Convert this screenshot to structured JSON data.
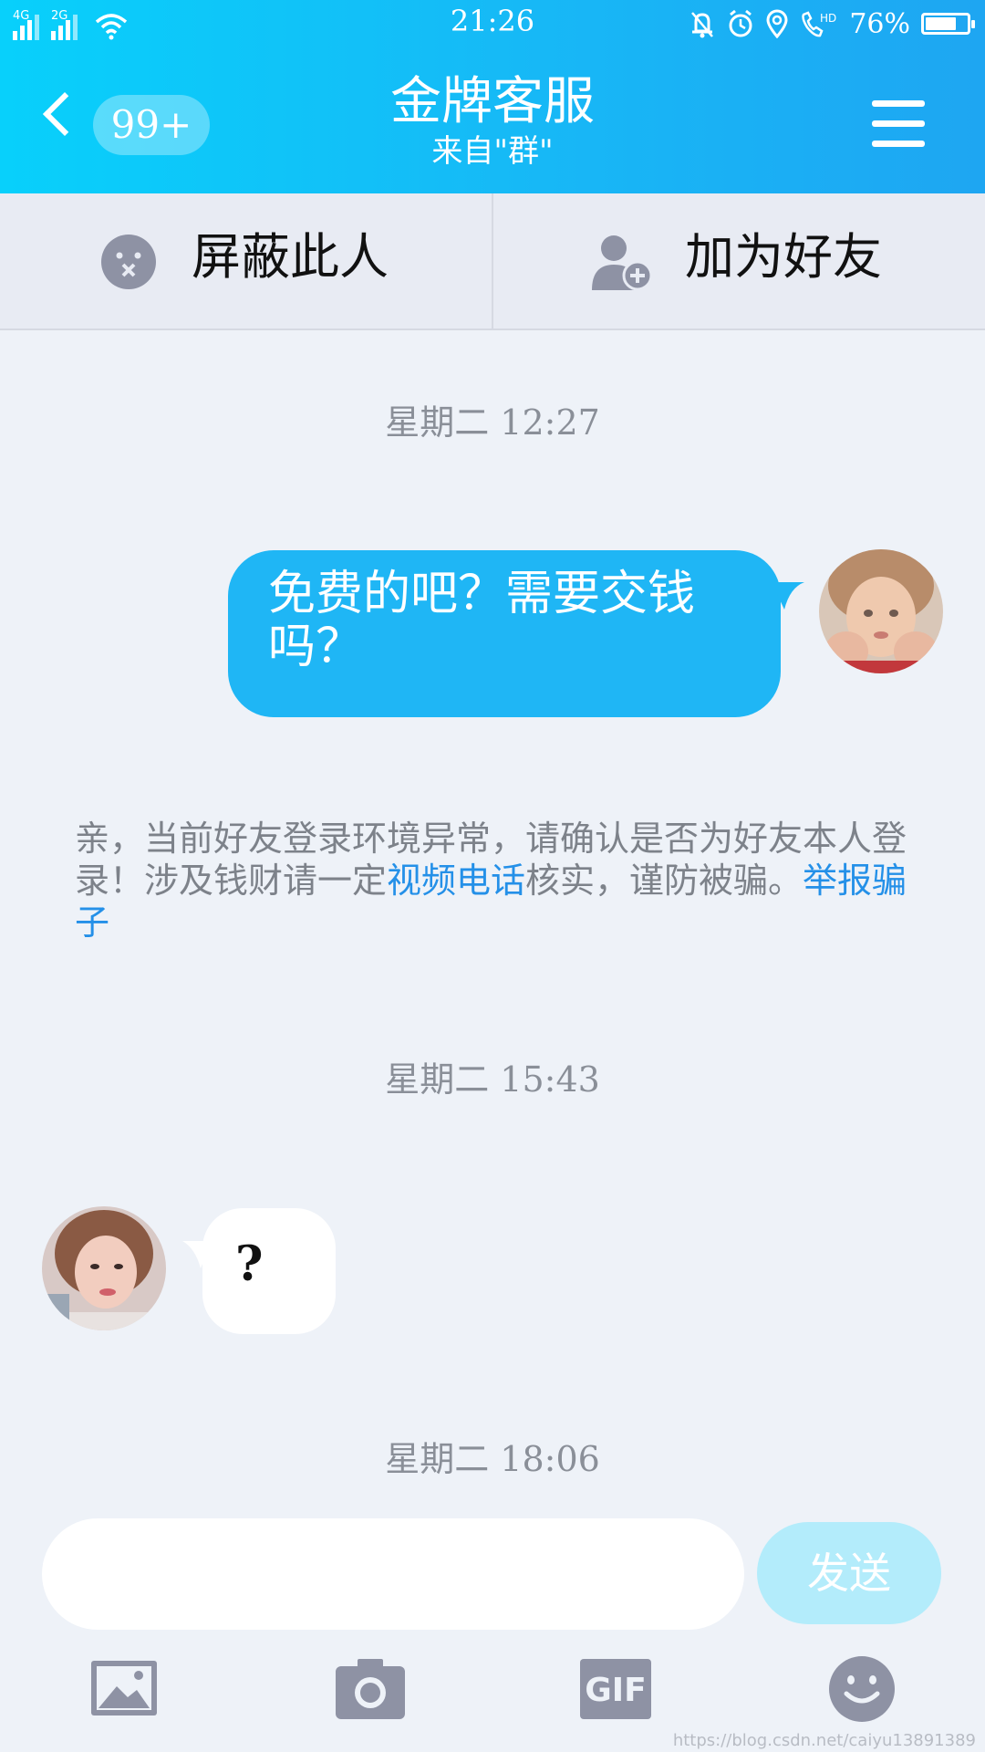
{
  "status_bar": {
    "network_1": "4G",
    "network_2": "2G",
    "time": "21:26",
    "battery_text": "76%",
    "battery_level": 0.76,
    "icons": [
      "bell-off-icon",
      "alarm-icon",
      "location-icon",
      "hd-call-icon"
    ]
  },
  "header": {
    "unread_count": "99+",
    "title": "金牌客服",
    "subtitle": "来自\"群\"",
    "colors": {
      "gradient_start": "#08d0fb",
      "gradient_end": "#1ea6f2"
    }
  },
  "actions": {
    "block_label": "屏蔽此人",
    "add_friend_label": "加为好友"
  },
  "chat": {
    "timestamps": [
      "星期二 12:27",
      "星期二 15:43",
      "星期二 18:06"
    ],
    "outgoing_message": "免费的吧？需要交钱吗？",
    "notice": {
      "part1": "亲，当前好友登录环境异常，请确认是否为好友本人登录！涉及钱财请一定",
      "link_video": "视频电话",
      "part2": "核实，谨防被骗。",
      "link_report": "举报骗子"
    },
    "incoming_message": "?"
  },
  "input": {
    "value": "",
    "send_label": "发送"
  },
  "toolbar": {
    "gif_label": "GIF",
    "icons": [
      "image-icon",
      "camera-icon",
      "gif-icon",
      "emoji-icon"
    ]
  },
  "watermark": "https://blog.csdn.net/caiyu13891389"
}
